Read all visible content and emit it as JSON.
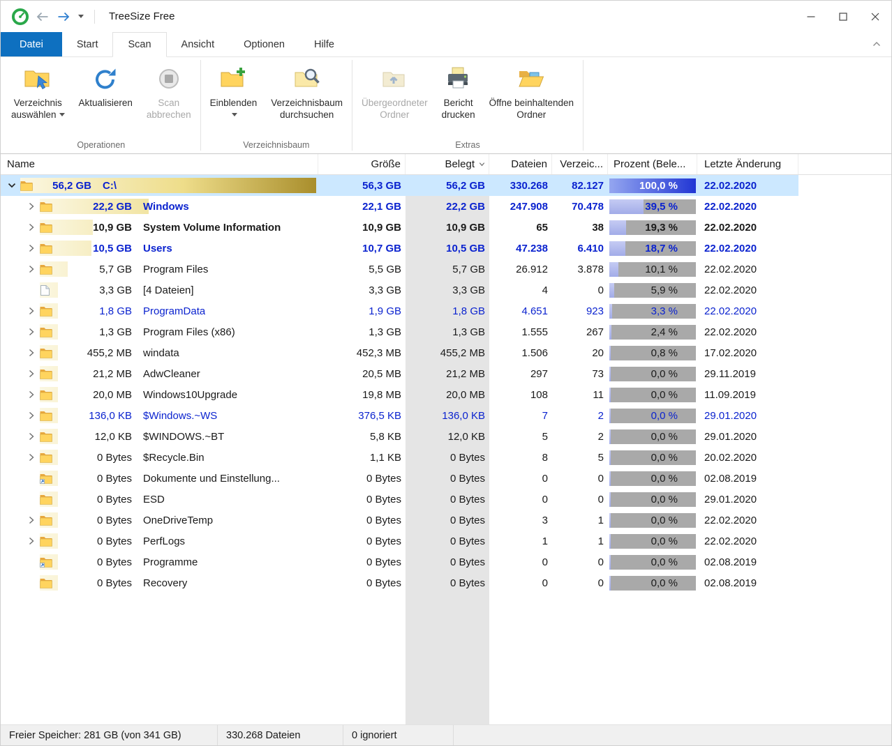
{
  "window": {
    "title": "TreeSize Free"
  },
  "tabs": [
    {
      "label": "Datei"
    },
    {
      "label": "Start"
    },
    {
      "label": "Scan"
    },
    {
      "label": "Ansicht"
    },
    {
      "label": "Optionen"
    },
    {
      "label": "Hilfe"
    }
  ],
  "ribbon": {
    "groups": [
      {
        "label": "Operationen",
        "buttons": [
          {
            "label1": "Verzeichnis",
            "label2": "auswählen",
            "icon": "folder-select-icon",
            "enabled": true,
            "dropdown": true
          },
          {
            "label1": "Aktualisieren",
            "label2": "",
            "icon": "refresh-icon",
            "enabled": true,
            "dropdown": false
          },
          {
            "label1": "Scan",
            "label2": "abbrechen",
            "icon": "stop-icon",
            "enabled": false,
            "dropdown": false
          }
        ]
      },
      {
        "label": "Verzeichnisbaum",
        "buttons": [
          {
            "label1": "Einblenden",
            "label2": "",
            "icon": "folder-add-icon",
            "enabled": true,
            "dropdown": true
          },
          {
            "label1": "Verzeichnisbaum",
            "label2": "durchsuchen",
            "icon": "folder-search-icon",
            "enabled": true,
            "dropdown": false
          }
        ]
      },
      {
        "label": "Extras",
        "buttons": [
          {
            "label1": "Übergeordneter",
            "label2": "Ordner",
            "icon": "parent-folder-icon",
            "enabled": false,
            "dropdown": false
          },
          {
            "label1": "Bericht",
            "label2": "drucken",
            "icon": "printer-icon",
            "enabled": true,
            "dropdown": false
          },
          {
            "label1": "Öffne beinhaltenden",
            "label2": "Ordner",
            "icon": "open-folder-icon",
            "enabled": true,
            "dropdown": false
          }
        ]
      }
    ]
  },
  "table": {
    "columns": [
      {
        "label": "Name"
      },
      {
        "label": "Größe"
      },
      {
        "label": "Belegt",
        "dropdown": true
      },
      {
        "label": "Dateien"
      },
      {
        "label": "Verzeic..."
      },
      {
        "label": "Prozent (Bele..."
      },
      {
        "label": "Letzte Änderung"
      }
    ],
    "rows": [
      {
        "level": 0,
        "chevron": "down",
        "icon": "folder",
        "size": "56,2 GB",
        "name": "C:\\",
        "groesse": "56,3 GB",
        "belegt": "56,2 GB",
        "dateien": "330.268",
        "verzeichnisse": "82.127",
        "prozent": "100,0 %",
        "prozent_value": 100.0,
        "datum": "22.02.2020",
        "style": "bold-blue",
        "selected": true
      },
      {
        "level": 1,
        "chevron": "right",
        "icon": "folder",
        "size": "22,2 GB",
        "name": "Windows",
        "groesse": "22,1 GB",
        "belegt": "22,2 GB",
        "dateien": "247.908",
        "verzeichnisse": "70.478",
        "prozent": "39,5 %",
        "prozent_value": 39.5,
        "datum": "22.02.2020",
        "style": "bold-blue",
        "selected": false
      },
      {
        "level": 1,
        "chevron": "right",
        "icon": "folder",
        "size": "10,9 GB",
        "name": "System Volume Information",
        "groesse": "10,9 GB",
        "belegt": "10,9 GB",
        "dateien": "65",
        "verzeichnisse": "38",
        "prozent": "19,3 %",
        "prozent_value": 19.3,
        "datum": "22.02.2020",
        "style": "bold",
        "selected": false
      },
      {
        "level": 1,
        "chevron": "right",
        "icon": "folder",
        "size": "10,5 GB",
        "name": "Users",
        "groesse": "10,7 GB",
        "belegt": "10,5 GB",
        "dateien": "47.238",
        "verzeichnisse": "6.410",
        "prozent": "18,7 %",
        "prozent_value": 18.7,
        "datum": "22.02.2020",
        "style": "bold-blue",
        "selected": false
      },
      {
        "level": 1,
        "chevron": "right",
        "icon": "folder",
        "size": "5,7 GB",
        "name": "Program Files",
        "groesse": "5,5 GB",
        "belegt": "5,7 GB",
        "dateien": "26.912",
        "verzeichnisse": "3.878",
        "prozent": "10,1 %",
        "prozent_value": 10.1,
        "datum": "22.02.2020",
        "style": "normal",
        "selected": false
      },
      {
        "level": 1,
        "chevron": "none",
        "icon": "file",
        "size": "3,3 GB",
        "name": "[4 Dateien]",
        "groesse": "3,3 GB",
        "belegt": "3,3 GB",
        "dateien": "4",
        "verzeichnisse": "0",
        "prozent": "5,9 %",
        "prozent_value": 5.9,
        "datum": "22.02.2020",
        "style": "normal",
        "selected": false
      },
      {
        "level": 1,
        "chevron": "right",
        "icon": "folder",
        "size": "1,8 GB",
        "name": "ProgramData",
        "groesse": "1,9 GB",
        "belegt": "1,8 GB",
        "dateien": "4.651",
        "verzeichnisse": "923",
        "prozent": "3,3 %",
        "prozent_value": 3.3,
        "datum": "22.02.2020",
        "style": "blue",
        "selected": false
      },
      {
        "level": 1,
        "chevron": "right",
        "icon": "folder",
        "size": "1,3 GB",
        "name": "Program Files (x86)",
        "groesse": "1,3 GB",
        "belegt": "1,3 GB",
        "dateien": "1.555",
        "verzeichnisse": "267",
        "prozent": "2,4 %",
        "prozent_value": 2.4,
        "datum": "22.02.2020",
        "style": "normal",
        "selected": false
      },
      {
        "level": 1,
        "chevron": "right",
        "icon": "folder",
        "size": "455,2 MB",
        "name": "windata",
        "groesse": "452,3 MB",
        "belegt": "455,2 MB",
        "dateien": "1.506",
        "verzeichnisse": "20",
        "prozent": "0,8 %",
        "prozent_value": 0.8,
        "datum": "17.02.2020",
        "style": "normal",
        "selected": false
      },
      {
        "level": 1,
        "chevron": "right",
        "icon": "folder",
        "size": "21,2 MB",
        "name": "AdwCleaner",
        "groesse": "20,5 MB",
        "belegt": "21,2 MB",
        "dateien": "297",
        "verzeichnisse": "73",
        "prozent": "0,0 %",
        "prozent_value": 0.0,
        "datum": "29.11.2019",
        "style": "normal",
        "selected": false
      },
      {
        "level": 1,
        "chevron": "right",
        "icon": "folder",
        "size": "20,0 MB",
        "name": "Windows10Upgrade",
        "groesse": "19,8 MB",
        "belegt": "20,0 MB",
        "dateien": "108",
        "verzeichnisse": "11",
        "prozent": "0,0 %",
        "prozent_value": 0.0,
        "datum": "11.09.2019",
        "style": "normal",
        "selected": false
      },
      {
        "level": 1,
        "chevron": "right",
        "icon": "folder",
        "size": "136,0 KB",
        "name": "$Windows.~WS",
        "groesse": "376,5 KB",
        "belegt": "136,0 KB",
        "dateien": "7",
        "verzeichnisse": "2",
        "prozent": "0,0 %",
        "prozent_value": 0.0,
        "datum": "29.01.2020",
        "style": "blue",
        "selected": false
      },
      {
        "level": 1,
        "chevron": "right",
        "icon": "folder",
        "size": "12,0 KB",
        "name": "$WINDOWS.~BT",
        "groesse": "5,8 KB",
        "belegt": "12,0 KB",
        "dateien": "5",
        "verzeichnisse": "2",
        "prozent": "0,0 %",
        "prozent_value": 0.0,
        "datum": "29.01.2020",
        "style": "normal",
        "selected": false
      },
      {
        "level": 1,
        "chevron": "right",
        "icon": "folder",
        "size": "0 Bytes",
        "name": "$Recycle.Bin",
        "groesse": "1,1 KB",
        "belegt": "0 Bytes",
        "dateien": "8",
        "verzeichnisse": "5",
        "prozent": "0,0 %",
        "prozent_value": 0.0,
        "datum": "20.02.2020",
        "style": "normal",
        "selected": false
      },
      {
        "level": 1,
        "chevron": "none",
        "icon": "folder-link",
        "size": "0 Bytes",
        "name": "Dokumente und Einstellung...",
        "groesse": "0 Bytes",
        "belegt": "0 Bytes",
        "dateien": "0",
        "verzeichnisse": "0",
        "prozent": "0,0 %",
        "prozent_value": 0.0,
        "datum": "02.08.2019",
        "style": "normal",
        "selected": false
      },
      {
        "level": 1,
        "chevron": "none",
        "icon": "folder",
        "size": "0 Bytes",
        "name": "ESD",
        "groesse": "0 Bytes",
        "belegt": "0 Bytes",
        "dateien": "0",
        "verzeichnisse": "0",
        "prozent": "0,0 %",
        "prozent_value": 0.0,
        "datum": "29.01.2020",
        "style": "normal",
        "selected": false
      },
      {
        "level": 1,
        "chevron": "right",
        "icon": "folder",
        "size": "0 Bytes",
        "name": "OneDriveTemp",
        "groesse": "0 Bytes",
        "belegt": "0 Bytes",
        "dateien": "3",
        "verzeichnisse": "1",
        "prozent": "0,0 %",
        "prozent_value": 0.0,
        "datum": "22.02.2020",
        "style": "normal",
        "selected": false
      },
      {
        "level": 1,
        "chevron": "right",
        "icon": "folder",
        "size": "0 Bytes",
        "name": "PerfLogs",
        "groesse": "0 Bytes",
        "belegt": "0 Bytes",
        "dateien": "1",
        "verzeichnisse": "1",
        "prozent": "0,0 %",
        "prozent_value": 0.0,
        "datum": "22.02.2020",
        "style": "normal",
        "selected": false
      },
      {
        "level": 1,
        "chevron": "none",
        "icon": "folder-link",
        "size": "0 Bytes",
        "name": "Programme",
        "groesse": "0 Bytes",
        "belegt": "0 Bytes",
        "dateien": "0",
        "verzeichnisse": "0",
        "prozent": "0,0 %",
        "prozent_value": 0.0,
        "datum": "02.08.2019",
        "style": "normal",
        "selected": false
      },
      {
        "level": 1,
        "chevron": "none",
        "icon": "folder",
        "size": "0 Bytes",
        "name": "Recovery",
        "groesse": "0 Bytes",
        "belegt": "0 Bytes",
        "dateien": "0",
        "verzeichnisse": "0",
        "prozent": "0,0 %",
        "prozent_value": 0.0,
        "datum": "02.08.2019",
        "style": "normal",
        "selected": false
      }
    ]
  },
  "statusbar": {
    "free_space": "Freier Speicher: 281 GB  (von 341 GB)",
    "files": "330.268 Dateien",
    "ignored": "0 ignoriert"
  },
  "colors": {
    "accent_blue": "#0e70c0",
    "selection": "#cce8ff",
    "compressed_text": "#0b23cf",
    "bar_gold_dark": "#a98e2c",
    "bar_gray": "#a9a9a9",
    "bar_fill_blue": "#2136d4"
  }
}
